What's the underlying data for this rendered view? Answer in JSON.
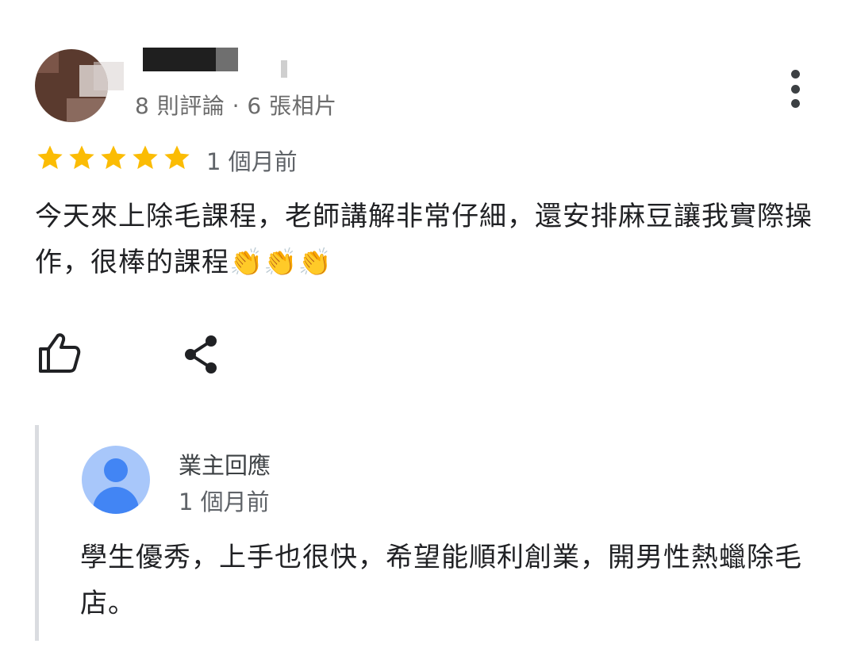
{
  "review": {
    "reviewer_meta": "8 則評論 · 6 張相片",
    "rating": 5,
    "rating_max": 5,
    "time": "1 個月前",
    "text": "今天來上除毛課程，老師講解非常仔細，還安排麻豆讓我實際操作，很棒的課程👏👏👏",
    "actions": {
      "like_icon": "thumb-up-icon",
      "share_icon": "share-icon",
      "more_icon": "more-vertical-icon"
    }
  },
  "owner_reply": {
    "label": "業主回應",
    "time": "1 個月前",
    "text": "學生優秀，上手也很快，希望能順利創業，開男性熱蠟除毛店。",
    "avatar_icon": "person-avatar-icon"
  },
  "colors": {
    "star": "#fbbc04",
    "meta_text": "#6b6b6b",
    "owner_avatar_bg": "#a8c7fa",
    "owner_avatar_fg": "#4285f4",
    "reply_border": "#dadce0"
  }
}
